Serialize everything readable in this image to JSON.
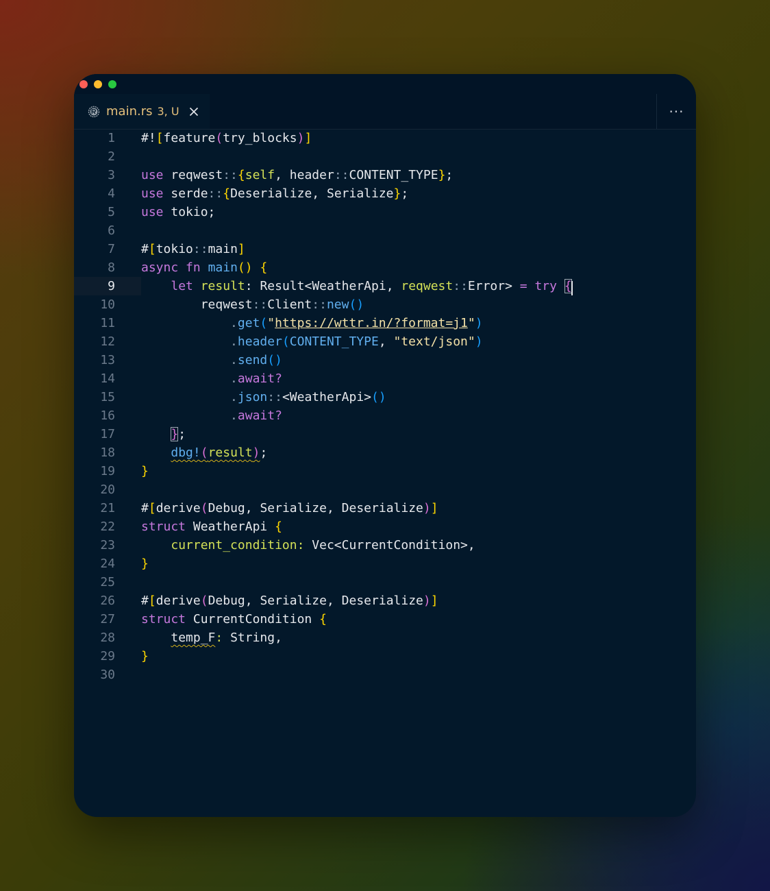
{
  "window": {
    "tab": {
      "icon": "rust-icon",
      "filename": "main.rs",
      "status": "3, U",
      "close_icon": "close-icon"
    },
    "more_label": "···"
  },
  "editor": {
    "active_line": 9,
    "lines": [
      {
        "n": "1"
      },
      {
        "n": "2"
      },
      {
        "n": "3"
      },
      {
        "n": "4"
      },
      {
        "n": "5"
      },
      {
        "n": "6"
      },
      {
        "n": "7"
      },
      {
        "n": "8"
      },
      {
        "n": "9"
      },
      {
        "n": "10"
      },
      {
        "n": "11"
      },
      {
        "n": "12"
      },
      {
        "n": "13"
      },
      {
        "n": "14"
      },
      {
        "n": "15"
      },
      {
        "n": "16"
      },
      {
        "n": "17"
      },
      {
        "n": "18"
      },
      {
        "n": "19"
      },
      {
        "n": "20"
      },
      {
        "n": "21"
      },
      {
        "n": "22"
      },
      {
        "n": "23"
      },
      {
        "n": "24"
      },
      {
        "n": "25"
      },
      {
        "n": "26"
      },
      {
        "n": "27"
      },
      {
        "n": "28"
      },
      {
        "n": "29"
      },
      {
        "n": "30"
      }
    ],
    "code": {
      "l1": {
        "attr_hash": "#!",
        "open": "[",
        "name": "feature",
        "p_open": "(",
        "arg": "try_blocks",
        "p_close": ")",
        "close": "]"
      },
      "l3": {
        "use": "use",
        "crate": "reqwest",
        "sep": "::",
        "open": "{",
        "self": "self",
        "comma": ", ",
        "mod": "header",
        "sep2": "::",
        "item": "CONTENT_TYPE",
        "close": "}",
        "semi": ";"
      },
      "l4": {
        "use": "use",
        "crate": "serde",
        "sep": "::",
        "open": "{",
        "a": "Deserialize",
        "comma": ", ",
        "b": "Serialize",
        "close": "}",
        "semi": ";"
      },
      "l5": {
        "use": "use",
        "crate": "tokio",
        "semi": ";"
      },
      "l7": {
        "hash": "#",
        "open": "[",
        "path": "tokio",
        "sep": "::",
        "name": "main",
        "close": "]"
      },
      "l8": {
        "async": "async",
        "fn": "fn",
        "name": "main",
        "parens": "()",
        "open": "{"
      },
      "l9": {
        "let": "let",
        "var": "result",
        "colon": ": ",
        "type": "Result",
        "lt": "<",
        "t1": "WeatherApi",
        "comma": ", ",
        "crate": "reqwest",
        "sep": "::",
        "t2": "Error",
        "gt": ">",
        "eq": " = ",
        "try": "try",
        "open": "{"
      },
      "l10": {
        "crate": "reqwest",
        "sep": "::",
        "type": "Client",
        "sep2": "::",
        "fn": "new",
        "parens": "()"
      },
      "l11": {
        "dot": ".",
        "fn": "get",
        "p_open": "(",
        "q1": "\"",
        "url": "https://wttr.in/?format=j1",
        "q2": "\"",
        "p_close": ")"
      },
      "l12": {
        "dot": ".",
        "fn": "header",
        "p_open": "(",
        "arg": "CONTENT_TYPE",
        "comma": ", ",
        "str": "\"text/json\"",
        "p_close": ")"
      },
      "l13": {
        "dot": ".",
        "fn": "send",
        "parens": "()"
      },
      "l14": {
        "dot": ".",
        "kw": "await",
        "q": "?"
      },
      "l15": {
        "dot": ".",
        "fn": "json",
        "sep": "::",
        "lt": "<",
        "type": "WeatherApi",
        "gt": ">",
        "parens": "()"
      },
      "l16": {
        "dot": ".",
        "kw": "await",
        "q": "?"
      },
      "l17": {
        "close": "}",
        "semi": ";"
      },
      "l18": {
        "macro": "dbg!",
        "p_open": "(",
        "arg": "result",
        "p_close": ")",
        "semi": ";"
      },
      "l19": {
        "close": "}"
      },
      "l21": {
        "hash": "#",
        "open": "[",
        "name": "derive",
        "p_open": "(",
        "a": "Debug",
        "c1": ", ",
        "b": "Serialize",
        "c2": ", ",
        "c": "Deserialize",
        "p_close": ")",
        "close": "]"
      },
      "l22": {
        "kw": "struct",
        "name": "WeatherApi",
        "open": "{"
      },
      "l23": {
        "field": "current_condition",
        "colon": ": ",
        "type": "Vec",
        "lt": "<",
        "inner": "CurrentCondition",
        "gt": ">",
        "comma": ","
      },
      "l24": {
        "close": "}"
      },
      "l26": {
        "hash": "#",
        "open": "[",
        "name": "derive",
        "p_open": "(",
        "a": "Debug",
        "c1": ", ",
        "b": "Serialize",
        "c2": ", ",
        "c": "Deserialize",
        "p_close": ")",
        "close": "]"
      },
      "l27": {
        "kw": "struct",
        "name": "CurrentCondition",
        "open": "{"
      },
      "l28": {
        "field": "temp_F",
        "colon": ": ",
        "type": "String",
        "comma": ","
      },
      "l29": {
        "close": "}"
      }
    }
  },
  "colors": {
    "window_bg": "#03182a",
    "keyword": "#c678dd",
    "function": "#61afef",
    "variable": "#d4e157",
    "string": "#f4e1a7",
    "bracket_gold": "#ffd700",
    "bracket_purple": "#da70d6",
    "bracket_blue": "#179fff",
    "tab_text": "#e5c07b"
  }
}
